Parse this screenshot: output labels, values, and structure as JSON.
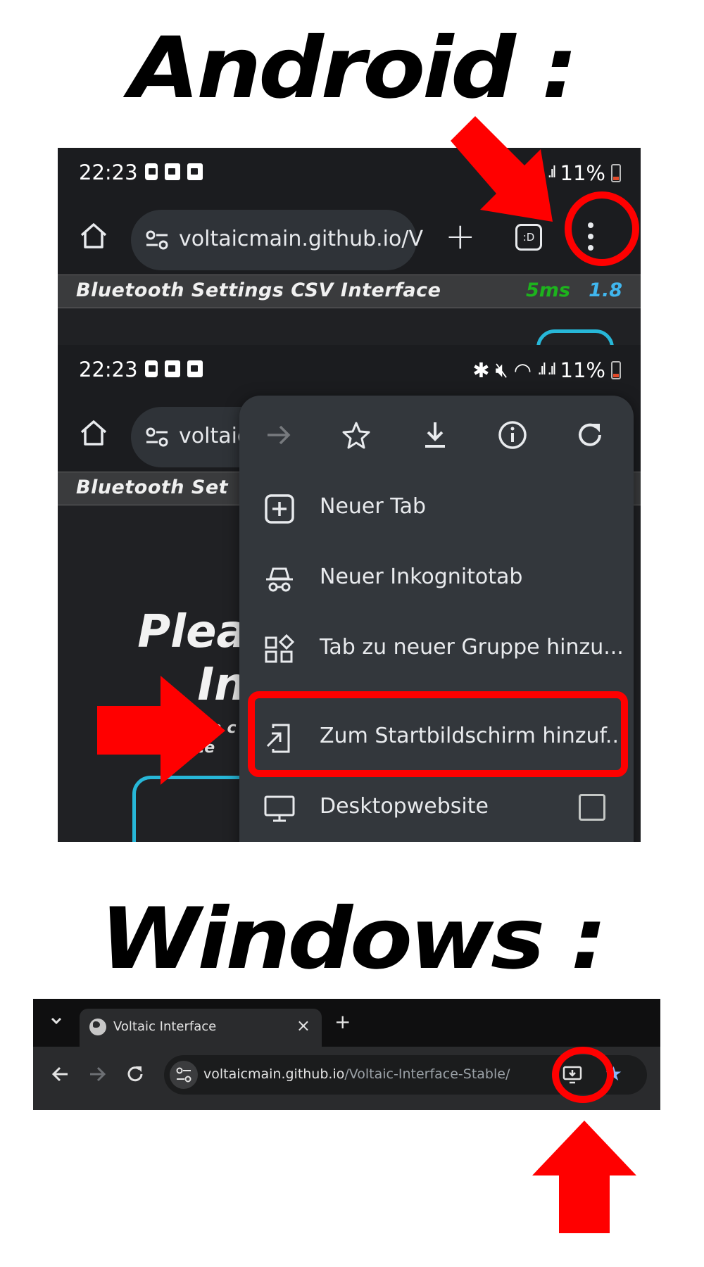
{
  "headings": {
    "android": "Android :",
    "windows": "Windows :"
  },
  "colors": {
    "annotation_red": "#ff0000",
    "chrome_dark": "#202124",
    "accent_cyan": "#27b7d8",
    "latency_green": "#1db31d",
    "version_blue": "#40b6ee"
  },
  "android_status": {
    "time": "22:23",
    "battery": "11%"
  },
  "android_toolbar": {
    "url": "voltaicmain.github.io/V",
    "url_short": "voltaic",
    "tabs_label": ":D"
  },
  "android_page": {
    "title": "Bluetooth Settings CSV Interface",
    "title_short": "Bluetooth Set",
    "latency": "5ms",
    "version": "1.8",
    "body_title_line1": "Pleas",
    "body_title_line2": "Inte",
    "body_sub_line1": "a c",
    "body_sub_line2": "erface"
  },
  "android_menu": {
    "top_icons": [
      "forward-icon",
      "star-icon",
      "download-icon",
      "info-icon",
      "refresh-icon"
    ],
    "items": [
      {
        "label": "Neuer Tab",
        "icon": "new-tab-icon"
      },
      {
        "label": "Neuer Inkognitotab",
        "icon": "incognito-icon"
      },
      {
        "label": "Tab zu neuer Gruppe hinzu...",
        "icon": "tab-group-icon"
      },
      {
        "label": "Zum Startbildschirm hinzuf...",
        "icon": "add-to-home-icon"
      },
      {
        "label": "Desktopwebsite",
        "icon": "desktop-icon"
      }
    ]
  },
  "windows_browser": {
    "tab_title": "Voltaic Interface",
    "tab_close": "×",
    "new_tab": "+",
    "url_host": "voltaicmain.github.io",
    "url_path": "/Voltaic-Interface-Stable/"
  }
}
